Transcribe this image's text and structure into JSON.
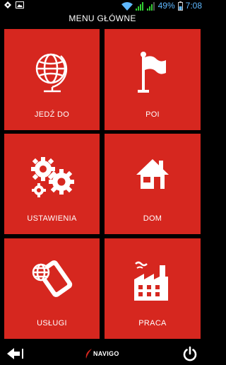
{
  "status_bar": {
    "battery_percent": "49%",
    "time": "7:08",
    "icons": [
      "location-icon",
      "image-icon",
      "wifi-icon",
      "signal-icon",
      "signal-icon",
      "battery-icon"
    ]
  },
  "header": {
    "title": "MENU GŁÓWNE"
  },
  "tiles": [
    {
      "label": "JEDŹ DO",
      "icon": "globe-icon"
    },
    {
      "label": "POI",
      "icon": "flag-icon"
    },
    {
      "label": "USTAWIENIA",
      "icon": "gears-icon"
    },
    {
      "label": "DOM",
      "icon": "home-icon"
    },
    {
      "label": "USŁUGI",
      "icon": "phone-globe-icon"
    },
    {
      "label": "PRACA",
      "icon": "factory-icon"
    }
  ],
  "footer": {
    "logo": "NAVIGO",
    "back_icon": "back-arrow-icon",
    "power_icon": "power-icon"
  },
  "colors": {
    "tile_red": "#d6271f",
    "background": "#000000",
    "battery_blue": "#5fb8ff"
  }
}
